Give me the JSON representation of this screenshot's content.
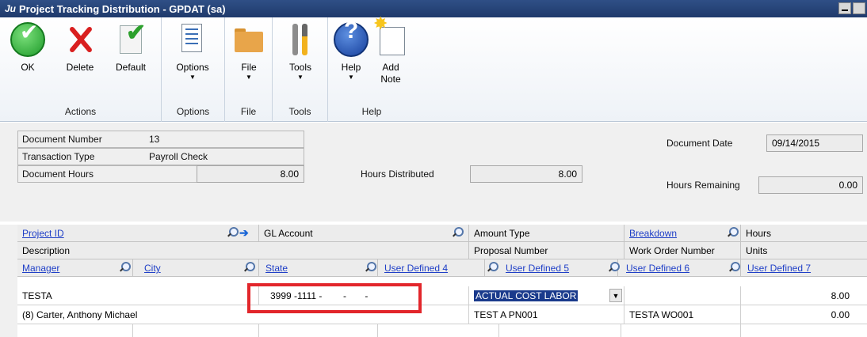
{
  "window": {
    "title": "Project Tracking Distribution  -  GPDAT (sa)",
    "app_glyph": "Ju"
  },
  "ribbon": {
    "groups": {
      "actions": "Actions",
      "options": "Options",
      "file": "File",
      "tools": "Tools",
      "help": "Help"
    },
    "buttons": {
      "ok": "OK",
      "delete": "Delete",
      "default": "Default",
      "options": "Options",
      "file": "File",
      "tools": "Tools",
      "help": "Help",
      "add_note_1": "Add",
      "add_note_2": "Note"
    },
    "dropdown_arrow": "▼"
  },
  "header": {
    "document_number_label": "Document Number",
    "document_number": "13",
    "transaction_type_label": "Transaction Type",
    "transaction_type": "Payroll Check",
    "document_hours_label": "Document Hours",
    "document_hours": "8.00",
    "hours_distributed_label": "Hours Distributed",
    "hours_distributed": "8.00",
    "document_date_label": "Document Date",
    "document_date": "09/14/2015",
    "hours_remaining_label": "Hours Remaining",
    "hours_remaining": "0.00"
  },
  "grid": {
    "header1": {
      "project_id": "Project ID",
      "gl_account": "GL Account",
      "amount_type": "Amount Type",
      "breakdown": "Breakdown",
      "hours": "Hours"
    },
    "header2": {
      "description": "Description",
      "proposal_number": "Proposal Number",
      "work_order_number": "Work Order Number",
      "units": "Units"
    },
    "header3": {
      "manager": "Manager",
      "city": "City",
      "state": "State",
      "user_defined_4": "User Defined 4",
      "user_defined_5": "User Defined 5",
      "user_defined_6": "User Defined 6",
      "user_defined_7": "User Defined 7"
    },
    "row1": {
      "project_id": "TESTA",
      "gl_account": "3999 -1111 -        -       -",
      "amount_type": "ACTUAL COST LABOR",
      "hours": "8.00"
    },
    "row2": {
      "description": "(8) Carter, Anthony Michael",
      "proposal_number": "TEST A PN001",
      "work_order_number": "TESTA WO001",
      "units": "0.00"
    }
  },
  "colors": {
    "title_bar": "#1f3a6b",
    "link": "#1f3fc7",
    "highlight": "#e2262b",
    "selection": "#1a3a8c"
  }
}
